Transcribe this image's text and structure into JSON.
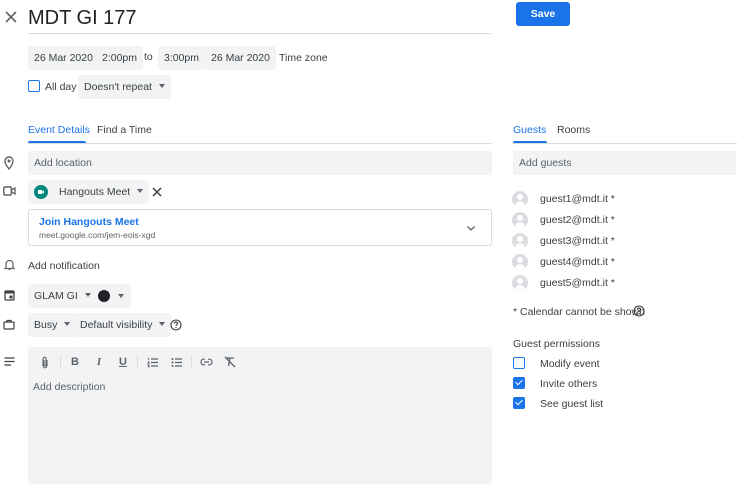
{
  "header": {
    "title": "MDT GI 177",
    "save_label": "Save"
  },
  "datetime": {
    "start_date": "26 Mar 2020",
    "start_time": "2:00pm",
    "to_label": "to",
    "end_time": "3:00pm",
    "end_date": "26 Mar 2020",
    "timezone_label": "Time zone",
    "all_day_label": "All day",
    "repeat_label": "Doesn't repeat"
  },
  "tabs": {
    "event_details": "Event Details",
    "find_a_time": "Find a Time",
    "guests": "Guests",
    "rooms": "Rooms"
  },
  "details": {
    "location_placeholder": "Add location",
    "conference_type": "Hangouts Meet",
    "join_label": "Join Hangouts Meet",
    "meet_url": "meet.google.com/jem-eois-xgd",
    "notification_label": "Add notification",
    "calendar_name": "GLAM GI",
    "calendar_color": "#202124",
    "busy_label": "Busy",
    "visibility_label": "Default visibility",
    "description_placeholder": "Add description"
  },
  "guests": {
    "add_placeholder": "Add guests",
    "list": [
      {
        "email": "guest1@mdt.it *"
      },
      {
        "email": "guest2@mdt.it *"
      },
      {
        "email": "guest3@mdt.it *"
      },
      {
        "email": "guest4@mdt.it *"
      },
      {
        "email": "guest5@mdt.it *"
      }
    ],
    "calendar_note": "* Calendar cannot be shown",
    "permissions_title": "Guest permissions",
    "permissions": [
      {
        "label": "Modify event",
        "checked": false
      },
      {
        "label": "Invite others",
        "checked": true
      },
      {
        "label": "See guest list",
        "checked": true
      }
    ]
  },
  "colors": {
    "accent": "#1a73e8",
    "field_bg": "#f1f3f4",
    "meet_green": "#00897b"
  }
}
